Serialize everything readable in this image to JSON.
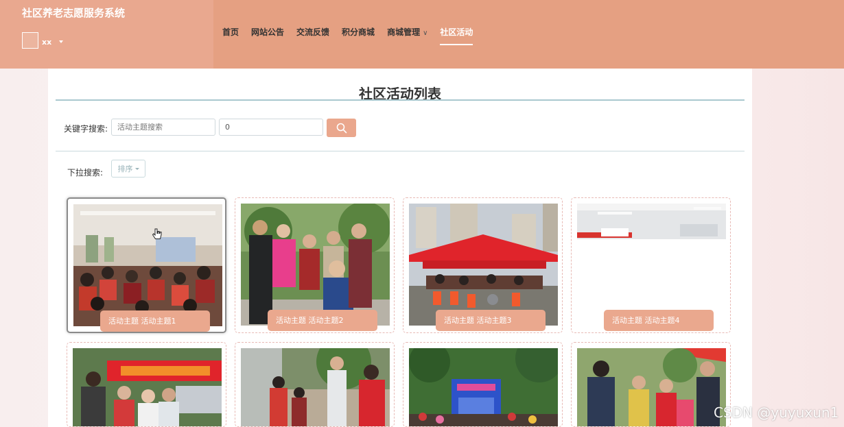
{
  "app": {
    "title": "社区养老志愿服务系统",
    "user_name": "xx"
  },
  "nav": [
    {
      "label": "首页"
    },
    {
      "label": "网站公告"
    },
    {
      "label": "交流反馈"
    },
    {
      "label": "积分商城"
    },
    {
      "label": "商城管理"
    },
    {
      "label": "社区活动"
    }
  ],
  "page": {
    "title": "社区活动列表"
  },
  "search": {
    "keyword_label": "关键字搜索:",
    "keyword_placeholder": "活动主题搜索",
    "number_value": "0",
    "dropdown_label": "下拉搜索:",
    "sort_label": "排序"
  },
  "cards": [
    {
      "caption": "活动主题  活动主题1"
    },
    {
      "caption": "活动主题  活动主题2"
    },
    {
      "caption": "活动主题  活动主题3"
    },
    {
      "caption": "活动主题  活动主题4"
    }
  ],
  "watermark": "CSDN @yuyuxun1",
  "colors": {
    "header": "#e5a082",
    "brand_bg": "#e9a88f",
    "accent": "#eaa78d"
  }
}
